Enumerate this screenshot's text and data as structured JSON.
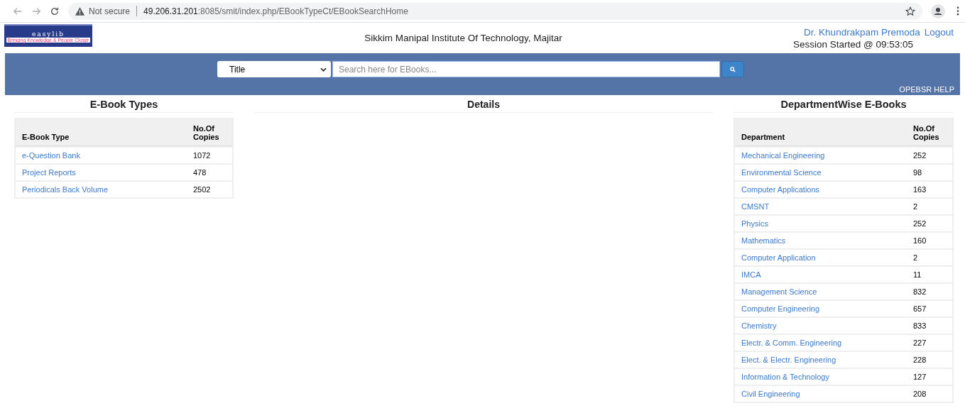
{
  "browser": {
    "security": "Not secure",
    "url_host": "49.206.31.201",
    "url_rest": ":8085/smit/index.php/EBookTypeCt/EBookSearchHome"
  },
  "logo": {
    "name": "easylib",
    "tagline": "Bringing Knowledge & People Closer"
  },
  "header": {
    "institute": "Sikkim Manipal Institute Of Technology, Majitar",
    "user": "Dr. Khundrakpam Premoda",
    "logout": "Logout",
    "session": "Session Started @ 09:53:05"
  },
  "search": {
    "field_select": "Title",
    "placeholder": "Search here for EBooks...",
    "help": "OPEBSR HELP"
  },
  "ebook_types": {
    "title": "E-Book Types",
    "columns": [
      "E-Book Type",
      "No.Of Copies"
    ],
    "rows": [
      {
        "name": "e-Question Bank",
        "copies": "1072"
      },
      {
        "name": "Project Reports",
        "copies": "478"
      },
      {
        "name": "Periodicals Back Volume",
        "copies": "2502"
      }
    ]
  },
  "details": {
    "title": "Details"
  },
  "departments": {
    "title": "DepartmentWise E-Books",
    "columns": [
      "Department",
      "No.Of Copies"
    ],
    "rows": [
      {
        "name": "Mechanical Engineering",
        "copies": "252"
      },
      {
        "name": "Environmental Science",
        "copies": "98"
      },
      {
        "name": "Computer Applications",
        "copies": "163"
      },
      {
        "name": "CMSNT",
        "copies": "2"
      },
      {
        "name": "Physics",
        "copies": "252"
      },
      {
        "name": "Mathematics",
        "copies": "160"
      },
      {
        "name": "Computer Application",
        "copies": "2"
      },
      {
        "name": "IMCA",
        "copies": "11"
      },
      {
        "name": "Management Science",
        "copies": "832"
      },
      {
        "name": "Computer Engineering",
        "copies": "657"
      },
      {
        "name": "Chemistry",
        "copies": "833"
      },
      {
        "name": "Electr. & Comm. Engineering",
        "copies": "227"
      },
      {
        "name": "Elect. & Electr. Engineering",
        "copies": "228"
      },
      {
        "name": "Information & Technology",
        "copies": "127"
      },
      {
        "name": "Civil Engineering",
        "copies": "208"
      }
    ]
  }
}
